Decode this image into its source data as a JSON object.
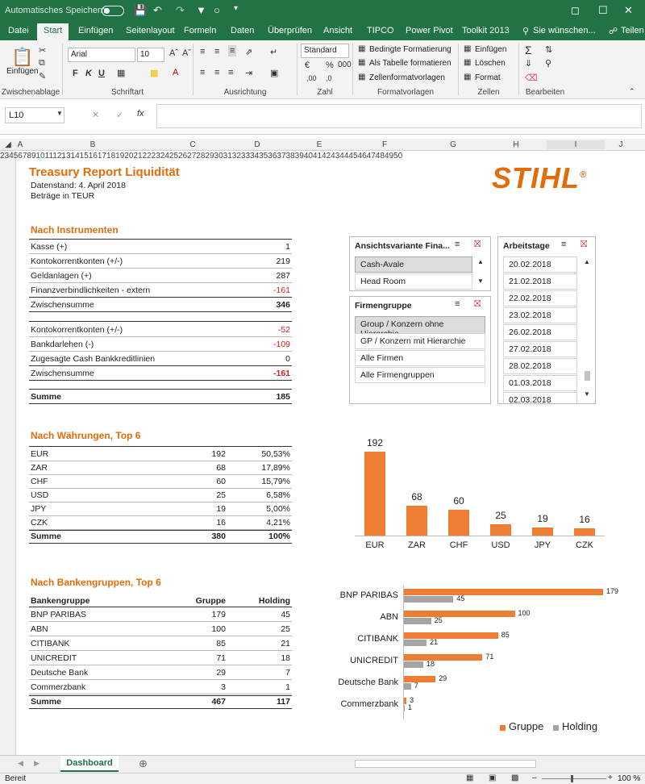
{
  "titlebar": {
    "autosave_label": "Automatisches Speichern",
    "window_controls": [
      "—",
      "☐",
      "✕"
    ]
  },
  "tabs": [
    "Datei",
    "Start",
    "Einfügen",
    "Seitenlayout",
    "Formeln",
    "Daten",
    "Überprüfen",
    "Ansicht",
    "TIPCO",
    "Power Pivot",
    "Toolkit 2013"
  ],
  "active_tab": "Start",
  "tell_me": "Sie wünschen...",
  "share": "Teilen",
  "ribbon": {
    "paste_label": "Einfügen",
    "font_name": "Arial",
    "font_size": "10",
    "bold": "F",
    "italic": "K",
    "underline": "U",
    "number_format": "Standard",
    "cond_format": "Bedingte Formatierung",
    "as_table": "Als Tabelle formatieren",
    "cell_styles": "Zellenformatvorlagen",
    "insert": "Einfügen",
    "delete": "Löschen",
    "format": "Format",
    "groups": [
      "Zwischenablage",
      "Schriftart",
      "Ausrichtung",
      "Zahl",
      "Formatvorlagen",
      "Zellen",
      "Bearbeiten"
    ]
  },
  "namebox": "L10",
  "fx": "fx",
  "columns": [
    "A",
    "B",
    "C",
    "D",
    "E",
    "F",
    "G",
    "H",
    "I",
    "J"
  ],
  "rows": [
    "2",
    "3",
    "4",
    "5",
    "6",
    "7",
    "8",
    "9",
    "10",
    "11",
    "12",
    "13",
    "14",
    "15",
    "16",
    "17",
    "18",
    "19",
    "20",
    "21",
    "22",
    "23",
    "24",
    "25",
    "26",
    "27",
    "28",
    "29",
    "30",
    "31",
    "32",
    "33",
    "34",
    "35",
    "36",
    "37",
    "38",
    "39",
    "40",
    "41",
    "42",
    "43",
    "44",
    "45",
    "46",
    "47",
    "48",
    "49",
    "50"
  ],
  "report": {
    "title": "Treasury Report Liquidität",
    "date": "Datenstand: 4. April 2018",
    "units": "Beträge in TEUR",
    "logo": "STIHL",
    "sec1": {
      "heading": "Nach Instrumenten",
      "rows": [
        {
          "label": "Kasse (+)",
          "value": "1"
        },
        {
          "label": "Kontokorrentkonten (+/-)",
          "value": "219"
        },
        {
          "label": "Geldanlagen (+)",
          "value": "287"
        },
        {
          "label": "Finanzverbindlichkeiten - extern",
          "value": "-161"
        },
        {
          "label": "Zwischensumme",
          "value": "346"
        },
        {
          "label": "Kontokorrentkonten (+/-)",
          "value": "-52"
        },
        {
          "label": "Bankdarlehen (-)",
          "value": "-109"
        },
        {
          "label": "Zugesagte Cash Bankkreditlinien",
          "value": "0"
        },
        {
          "label": "Zwischensumme",
          "value": "-161"
        },
        {
          "label": "Summe",
          "value": "185"
        }
      ]
    },
    "sec2": {
      "heading": "Nach Währungen, Top 6",
      "rows": [
        {
          "cur": "EUR",
          "val": "192",
          "pct": "50,53%"
        },
        {
          "cur": "ZAR",
          "val": "68",
          "pct": "17,89%"
        },
        {
          "cur": "CHF",
          "val": "60",
          "pct": "15,79%"
        },
        {
          "cur": "USD",
          "val": "25",
          "pct": "6,58%"
        },
        {
          "cur": "JPY",
          "val": "19",
          "pct": "5,00%"
        },
        {
          "cur": "CZK",
          "val": "16",
          "pct": "4,21%"
        }
      ],
      "total": {
        "cur": "Summe",
        "val": "380",
        "pct": "100%"
      }
    },
    "sec3": {
      "heading": "Nach Bankengruppen, Top 6",
      "headers": {
        "bank": "Bankengruppe",
        "gruppe": "Gruppe",
        "holding": "Holding"
      },
      "rows": [
        {
          "bank": "BNP PARIBAS",
          "gruppe": "179",
          "holding": "45"
        },
        {
          "bank": "ABN",
          "gruppe": "100",
          "holding": "25"
        },
        {
          "bank": "CITIBANK",
          "gruppe": "85",
          "holding": "21"
        },
        {
          "bank": "UNICREDIT",
          "gruppe": "71",
          "holding": "18"
        },
        {
          "bank": "Deutsche Bank",
          "gruppe": "29",
          "holding": "7"
        },
        {
          "bank": "Commerzbank",
          "gruppe": "3",
          "holding": "1"
        }
      ],
      "total": {
        "bank": "Summe",
        "gruppe": "467",
        "holding": "117"
      }
    }
  },
  "slicers": {
    "variant": {
      "title": "Ansichtsvariante Fina...",
      "items": [
        "Cash-Avale",
        "Head Room"
      ]
    },
    "firm": {
      "title": "Firmengruppe",
      "items": [
        "Group / Konzern ohne Hierarchie",
        "GP / Konzern mit Hierarchie",
        "Alle Firmen",
        "Alle Firmengruppen"
      ]
    },
    "days": {
      "title": "Arbeitstage",
      "items": [
        "20.02.2018",
        "21.02.2018",
        "22.02.2018",
        "23.02.2018",
        "26.02.2018",
        "27.02.2018",
        "28.02.2018",
        "01.03.2018",
        "02.03.2018"
      ]
    }
  },
  "chart_data": [
    {
      "type": "bar",
      "categories": [
        "EUR",
        "ZAR",
        "CHF",
        "USD",
        "JPY",
        "CZK"
      ],
      "values": [
        192,
        68,
        60,
        25,
        19,
        16
      ],
      "color": "#ed7d31"
    },
    {
      "type": "bar",
      "orientation": "horizontal",
      "categories": [
        "BNP PARIBAS",
        "ABN",
        "CITIBANK",
        "UNICREDIT",
        "Deutsche Bank",
        "Commerzbank"
      ],
      "series": [
        {
          "name": "Gruppe",
          "values": [
            179,
            100,
            85,
            71,
            29,
            3
          ],
          "color": "#ed7d31"
        },
        {
          "name": "Holding",
          "values": [
            45,
            25,
            21,
            18,
            7,
            1
          ],
          "color": "#a5a5a5"
        }
      ],
      "legend": "bottom-right"
    }
  ],
  "sheet_tab": "Dashboard",
  "status": {
    "ready": "Bereit",
    "zoom": "100 %"
  }
}
